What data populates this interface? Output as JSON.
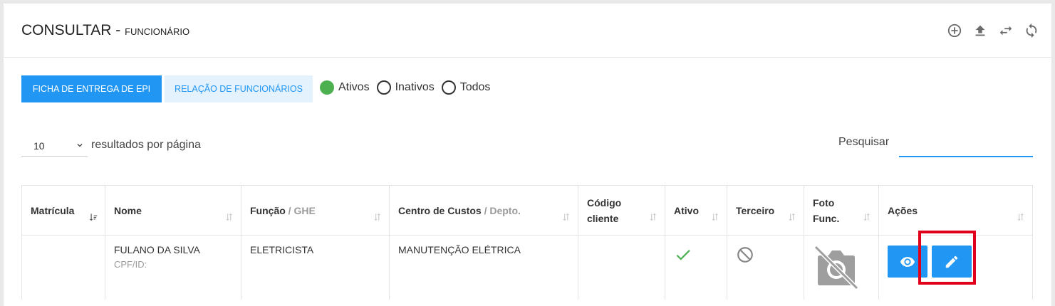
{
  "header": {
    "title": "CONSULTAR - ",
    "subtitle": "FUNCIONÁRIO",
    "icons": [
      "add-circle-icon",
      "upload-icon",
      "swap-icon",
      "refresh-icon"
    ]
  },
  "actions_bar": {
    "primary_label": "FICHA DE ENTREGA DE EPI",
    "secondary_label": "RELAÇÃO DE FUNCIONÁRIOS",
    "filters": [
      {
        "label": "Ativos",
        "selected": true
      },
      {
        "label": "Inativos",
        "selected": false
      },
      {
        "label": "Todos",
        "selected": false
      }
    ]
  },
  "pager": {
    "page_size": "10",
    "label": "resultados por página"
  },
  "search": {
    "label": "Pesquisar",
    "value": ""
  },
  "table": {
    "columns": [
      {
        "label": "Matrícula",
        "muted": ""
      },
      {
        "label": "Nome",
        "muted": ""
      },
      {
        "label": "Função",
        "muted": " / GHE"
      },
      {
        "label": "Centro de Custos",
        "muted": " / Depto."
      },
      {
        "label": "Código",
        "label2": "cliente"
      },
      {
        "label": "Ativo",
        "muted": ""
      },
      {
        "label": "Terceiro",
        "muted": ""
      },
      {
        "label": "Foto",
        "label2": "Func."
      },
      {
        "label": "Ações",
        "muted": ""
      }
    ],
    "rows": [
      {
        "matricula": "",
        "nome": "FULANO DA SILVA",
        "cpf_label": "CPF/ID:",
        "funcao": "ELETRICISTA",
        "centro_custos": "MANUTENÇÃO ELÉTRICA",
        "codigo_cliente": "",
        "ativo": true,
        "terceiro": false,
        "foto": "no-photo-icon"
      }
    ]
  },
  "colors": {
    "accent": "#2196f3",
    "active": "#4caf50",
    "highlight": "#e0001b"
  }
}
